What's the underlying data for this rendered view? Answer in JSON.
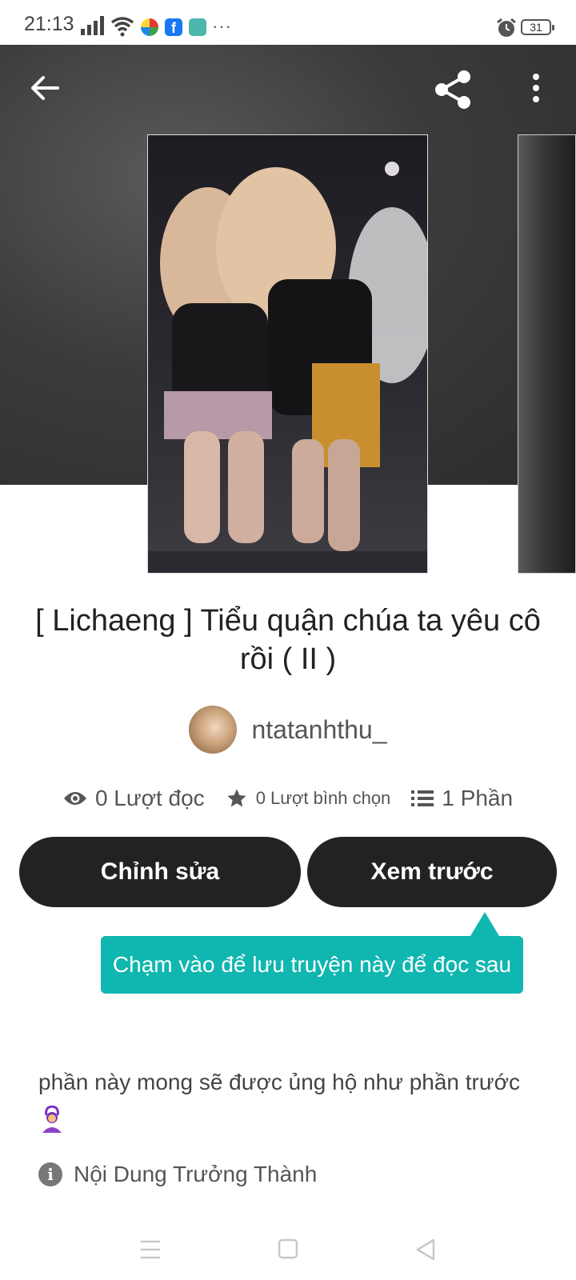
{
  "status_bar": {
    "time": "21:13",
    "battery": "31",
    "more": "···",
    "icons": [
      "signal-icon",
      "wifi-icon",
      "app-icon-colorful",
      "facebook-icon",
      "app-icon-green",
      "alarm-icon",
      "battery-icon"
    ]
  },
  "header": {
    "back_icon": "arrow-left-icon",
    "share_icon": "share-icon",
    "menu_icon": "more-vertical-icon"
  },
  "story": {
    "title": "[ Lichaeng ] Tiểu quận chúa ta yêu cô rồi ( II )",
    "author": "ntatanhthu_",
    "stats": {
      "reads": "0 Lượt đọc",
      "votes": "0 Lượt bình chọn",
      "parts": "1 Phần"
    }
  },
  "actions": {
    "edit_label": "Chỉnh sửa",
    "preview_label": "Xem trước"
  },
  "tooltip": {
    "text": "Chạm vào để lưu truyện này để đọc sau"
  },
  "description": {
    "text": "phần này mong sẽ được ủng hộ như phần trước"
  },
  "mature": {
    "label": "Nội Dung Trưởng Thành"
  },
  "colors": {
    "accent": "#10b6b0",
    "button_bg": "#222222",
    "hero_bg": "#3b3b3b"
  }
}
